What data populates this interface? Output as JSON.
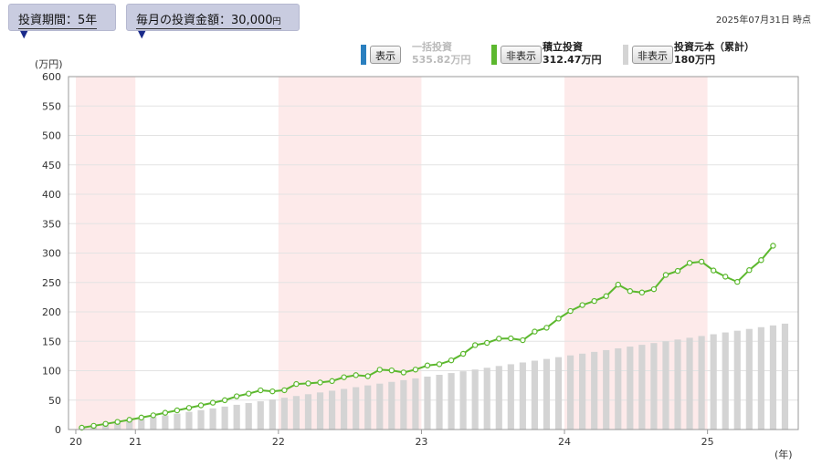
{
  "controls": {
    "period": {
      "label": "投資期間：",
      "value": "5年"
    },
    "monthly": {
      "label": "毎月の投資金額：",
      "value": "30,000",
      "unit": "円"
    },
    "as_of": "2025年07月31日 時点"
  },
  "legend": [
    {
      "button": "表示",
      "name": "一括投資",
      "value": "535.82万円",
      "color": "#2a7fbf",
      "visible": false
    },
    {
      "button": "非表示",
      "name": "積立投資",
      "value": "312.47万円",
      "color": "#5cb82e",
      "visible": true
    },
    {
      "button": "非表示",
      "name": "投資元本（累計）",
      "value": "180万円",
      "color": "#d4d4d4",
      "visible": true
    }
  ],
  "chart_data": {
    "type": "line",
    "ylabel": "(万円)",
    "xlabel": "(年)",
    "ylim": [
      0,
      600
    ],
    "yticks": [
      0,
      50,
      100,
      150,
      200,
      250,
      300,
      350,
      400,
      450,
      500,
      550,
      600
    ],
    "xticks": [
      "20",
      "21",
      "22",
      "23",
      "24",
      "25"
    ],
    "x_start": "2020-08",
    "x_end": "2025-07",
    "shaded_periods": [
      [
        "2020-08",
        "2020-12"
      ],
      [
        "2022-01",
        "2022-12"
      ],
      [
        "2024-01",
        "2024-12"
      ]
    ],
    "grid": true,
    "series": [
      {
        "name": "積立投資",
        "type": "line",
        "color": "#5cb82e",
        "values": [
          3.1,
          6.3,
          9.6,
          12.9,
          16.5,
          20.4,
          24.2,
          28.5,
          32.6,
          36.8,
          41.1,
          45.6,
          49.8,
          56.5,
          61.0,
          66.6,
          64.9,
          66.8,
          77.4,
          78.4,
          80.0,
          82.4,
          88.9,
          92.5,
          90.7,
          101.7,
          100.5,
          97.0,
          101.9,
          108.9,
          111.0,
          117.6,
          128.7,
          143.5,
          147.3,
          154.5,
          154.9,
          151.9,
          166.5,
          173.0,
          188.6,
          201.5,
          211.6,
          218.5,
          226.8,
          246.3,
          235.3,
          233.0,
          238.5,
          262.8,
          269.6,
          283.2,
          285.4,
          270.4,
          259.9,
          251.0,
          271.0,
          288.0,
          312.47
        ]
      },
      {
        "name": "投資元本（累計）",
        "type": "bar",
        "color": "#d4d4d4",
        "values": [
          3,
          6,
          9,
          12,
          15,
          18,
          21,
          24,
          27,
          30,
          33,
          36,
          39,
          42,
          45,
          48,
          51,
          54,
          57,
          60,
          63,
          66,
          69,
          72,
          75,
          78,
          81,
          84,
          87,
          90,
          93,
          96,
          99,
          102,
          105,
          108,
          111,
          114,
          117,
          120,
          123,
          126,
          129,
          132,
          135,
          138,
          141,
          144,
          147,
          150,
          153,
          156,
          159,
          162,
          165,
          168,
          171,
          174,
          177,
          180
        ]
      }
    ]
  }
}
